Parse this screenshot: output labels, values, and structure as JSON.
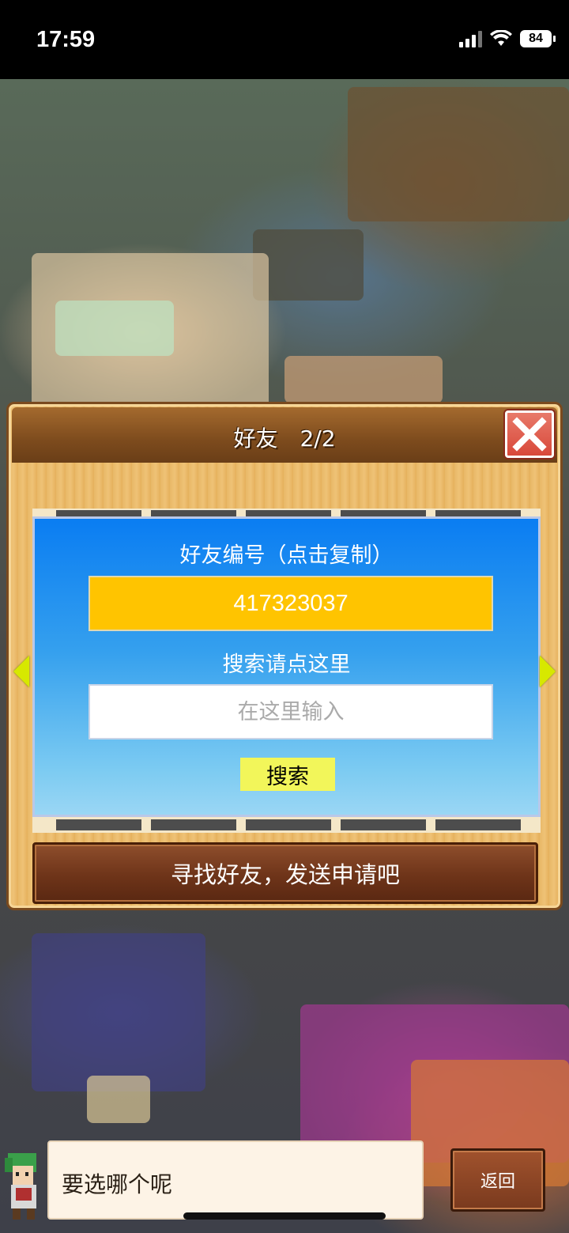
{
  "status_bar": {
    "time": "17:59",
    "battery": "84"
  },
  "dialog": {
    "title": "好友　2/2",
    "friend_id_label": "好友编号（点击复制）",
    "friend_id": "417323037",
    "search_label": "搜索请点这里",
    "search_placeholder": "在这里输入",
    "search_button": "搜索",
    "find_friends_button": "寻找好友，发送申请吧"
  },
  "bottom": {
    "speech_text": "要选哪个呢",
    "back_button": "返回"
  },
  "colors": {
    "id_box": "#ffc400",
    "search_button": "#f2f65a",
    "close_button": "#d8483a",
    "card_top": "#0a7df2"
  }
}
